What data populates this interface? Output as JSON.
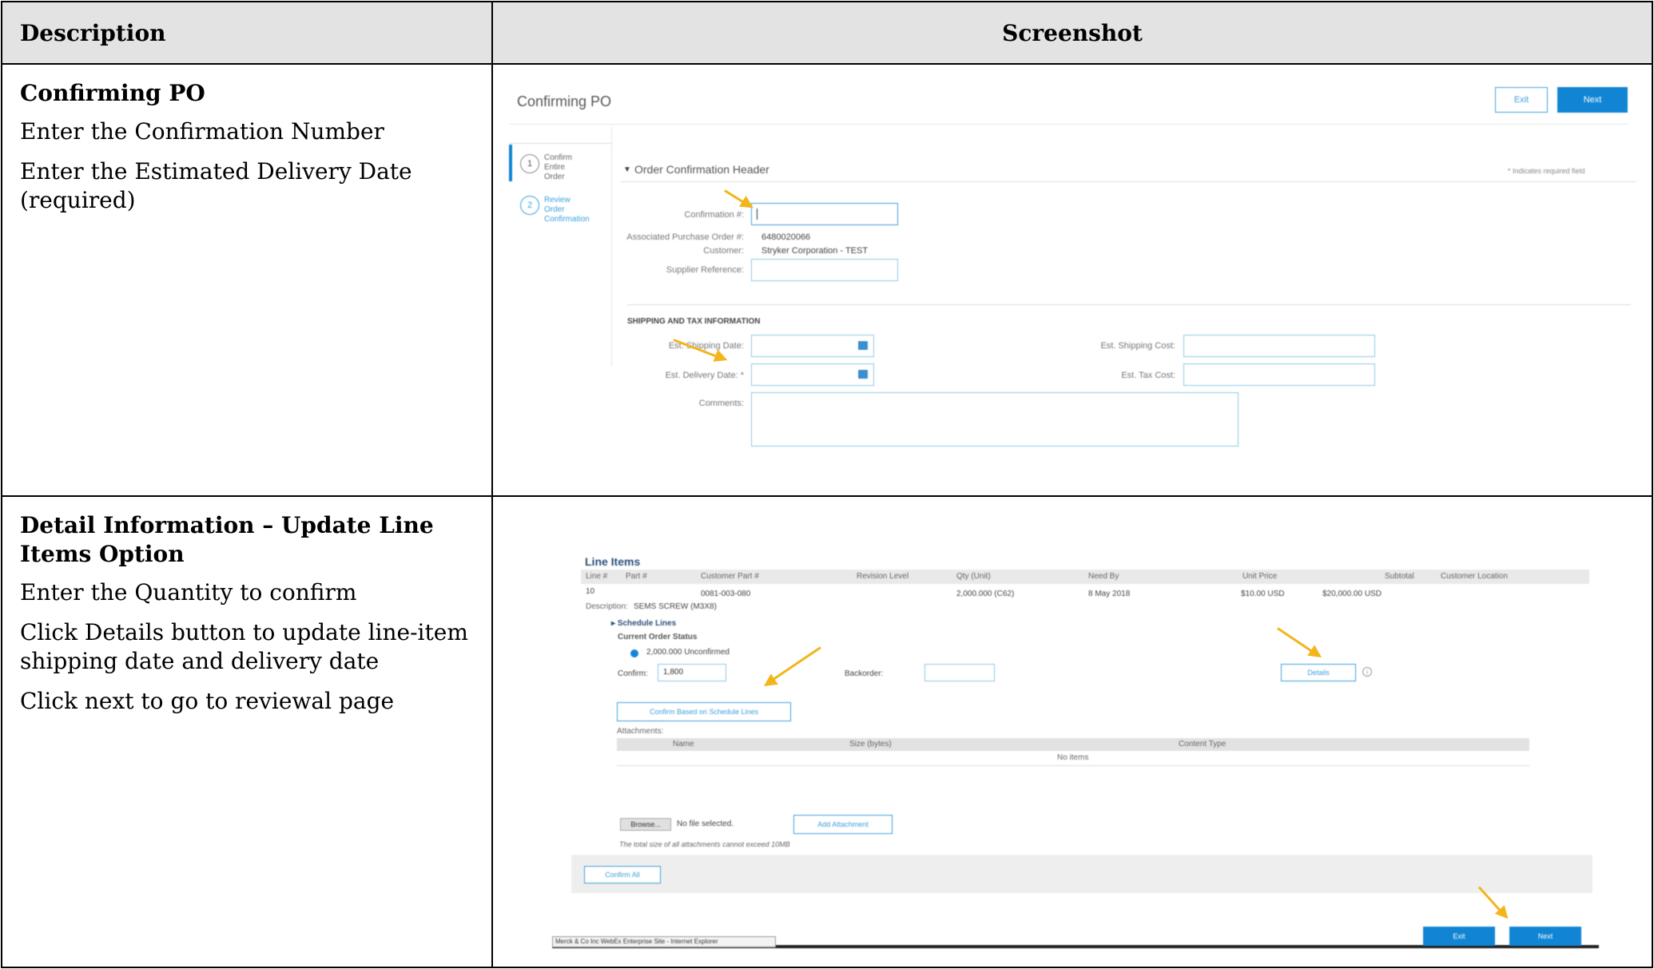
{
  "header": {
    "col1": "Description",
    "col2": "Screenshot"
  },
  "row1": {
    "title": "Confirming PO",
    "lines": [
      "Enter the Confirmation Number",
      "Enter the Estimated Delivery Date (required)"
    ],
    "ui": {
      "page_title": "Confirming PO",
      "exit": "Exit",
      "next": "Next",
      "step1": "Confirm Entire Order",
      "step2": "Review Order Confirmation",
      "step1_num": "1",
      "step2_num": "2",
      "section": "Order Confirmation Header",
      "required_note": "* Indicates required field",
      "confirmation_label": "Confirmation #:",
      "po_label": "Associated Purchase Order #:",
      "po_value": "6480020066",
      "customer_label": "Customer:",
      "customer_value": "Stryker Corporation - TEST",
      "supplier_ref_label": "Supplier Reference:",
      "shipping_heading": "SHIPPING AND TAX INFORMATION",
      "ship_date_label": "Est. Shipping Date:",
      "delivery_date_label": "Est. Delivery Date: *",
      "comments_label": "Comments:",
      "ship_cost_label": "Est. Shipping Cost:",
      "tax_cost_label": "Est. Tax Cost:"
    }
  },
  "row2": {
    "title": "Detail Information – Update Line Items Option",
    "lines": [
      "Enter the Quantity to confirm",
      "Click Details button to update line-item shipping date and delivery date",
      "Click next to go to reviewal page"
    ],
    "ui": {
      "heading": "Line Items",
      "columns": [
        "Line #",
        "Part #",
        "Customer Part #",
        "Revision Level",
        "Qty (Unit)",
        "Need By",
        "Unit Price",
        "Subtotal",
        "Customer Location"
      ],
      "line_no": "10",
      "cust_part": "0081-003-080",
      "qty": "2,000.000 (C62)",
      "need_by": "8 May 2018",
      "unit_price": "$10.00 USD",
      "subtotal": "$20,000.00 USD",
      "description_label": "Description:",
      "description_value": "SEMS SCREW (M3X8)",
      "schedule_lines": "Schedule Lines",
      "current_status": "Current Order Status",
      "unconfirmed": "2,000.000 Unconfirmed",
      "confirm_label": "Confirm:",
      "confirm_value": "1,800",
      "backorder_label": "Backorder:",
      "details": "Details",
      "confirm_schedule": "Confirm Based on Schedule Lines",
      "attachments": "Attachments:",
      "att_cols": [
        "Name",
        "Size (bytes)",
        "Content Type"
      ],
      "no_items": "No items",
      "browse": "Browse...",
      "no_file": "No file selected.",
      "add_attachment": "Add Attachment",
      "size_note": "The total size of all attachments cannot exceed 10MB",
      "confirm_all": "Confirm All",
      "exit": "Exit",
      "next": "Next",
      "taskbar": "Merck & Co Inc WebEx Enterprise Site - Internet Explorer"
    }
  },
  "colors": {
    "accent": "#1185d4",
    "arrow": "#f2b51c",
    "header_bg": "#e3e3e3"
  }
}
